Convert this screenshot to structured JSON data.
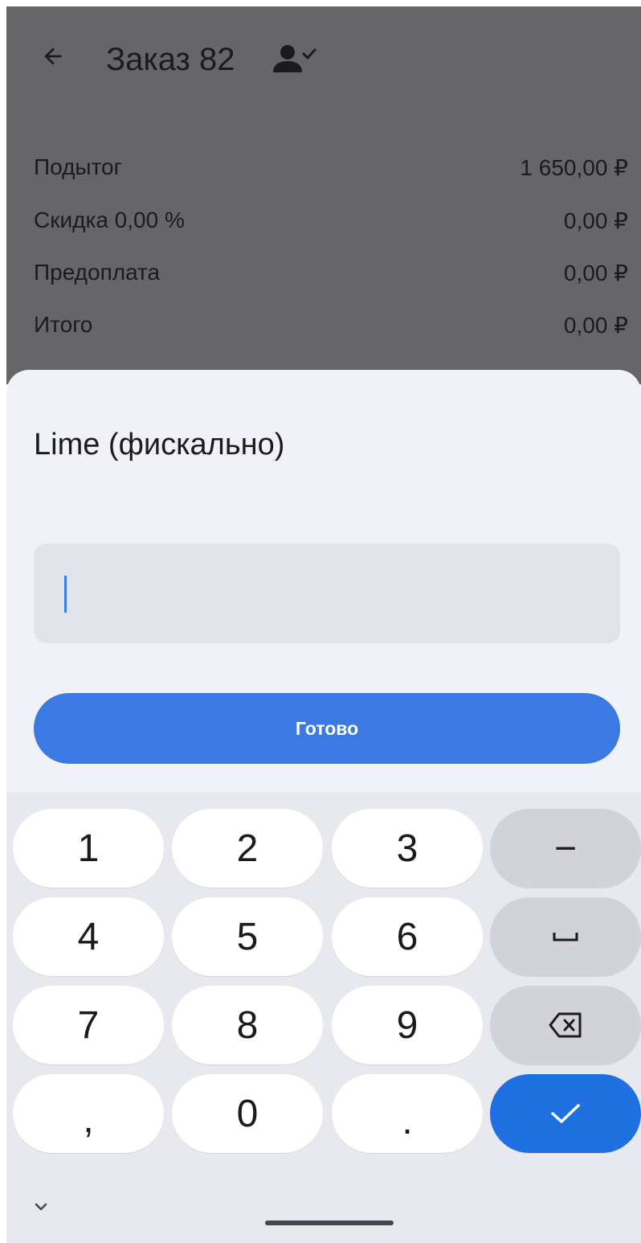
{
  "header": {
    "title": "Заказ 82",
    "back_icon": "arrow-left-icon",
    "customer_icon": "user-check-icon"
  },
  "summary": {
    "rows": [
      {
        "label": "Подытог",
        "value": "1 650,00 ₽"
      },
      {
        "label": "Скидка 0,00 %",
        "value": "0,00 ₽"
      },
      {
        "label": "Предоплата",
        "value": "0,00 ₽"
      },
      {
        "label": "Итого",
        "value": "0,00 ₽"
      }
    ]
  },
  "payment_sheet": {
    "title": "Lime (фискально)",
    "amount_value": "",
    "done_label": "Готово"
  },
  "keyboard": {
    "keys": [
      "1",
      "2",
      "3",
      "−",
      "4",
      "5",
      "6",
      "␣",
      "7",
      "8",
      "9",
      "⌫",
      ",",
      "0",
      ".",
      "✓"
    ],
    "enter_icon": "check-icon",
    "backspace_icon": "backspace-icon",
    "hide_icon": "chevron-down-icon"
  },
  "colors": {
    "overlay": "#666668",
    "sheet_bg": "#f1f2f7",
    "accent": "#3b7ae3",
    "enter_key": "#1e6fdf",
    "keyboard_bg": "#e8e9ee"
  }
}
